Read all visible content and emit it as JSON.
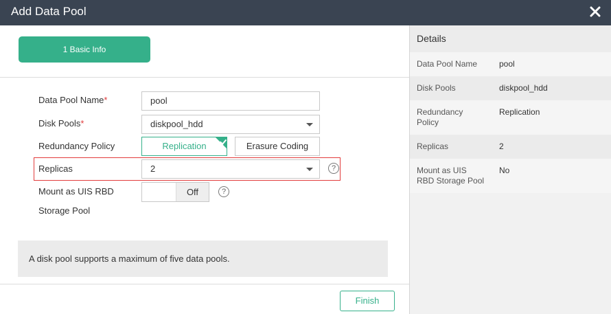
{
  "dialog": {
    "title": "Add Data Pool"
  },
  "steps": {
    "step1": "1 Basic Info"
  },
  "form": {
    "pool_name_label": "Data Pool Name",
    "pool_name_value": "pool",
    "disk_pools_label": "Disk Pools",
    "disk_pools_value": "diskpool_hdd",
    "required_mark": "*",
    "redundancy_label": "Redundancy Policy",
    "redundancy_options": [
      "Replication",
      "Erasure Coding"
    ],
    "replicas_label": "Replicas",
    "replicas_value": "2",
    "mount_label_line1": "Mount as UIS RBD",
    "mount_label_line2": "Storage Pool",
    "mount_toggle_value": "Off",
    "help_glyph": "?"
  },
  "notice": "A disk pool supports a maximum of five data pools.",
  "buttons": {
    "finish": "Finish"
  },
  "details": {
    "title": "Details",
    "rows": [
      {
        "key": "Data Pool Name",
        "value": "pool"
      },
      {
        "key": "Disk Pools",
        "value": "diskpool_hdd"
      },
      {
        "key_line1": "Redundancy",
        "key_line2": "Policy",
        "value": "Replication"
      },
      {
        "key": "Replicas",
        "value": "2"
      },
      {
        "key_line1": "Mount as UIS",
        "key_line2": "RBD Storage Pool",
        "value": "No"
      }
    ]
  },
  "colors": {
    "accent": "#35b08a",
    "titlebar": "#3a4452",
    "highlight": "#e23b3b"
  }
}
